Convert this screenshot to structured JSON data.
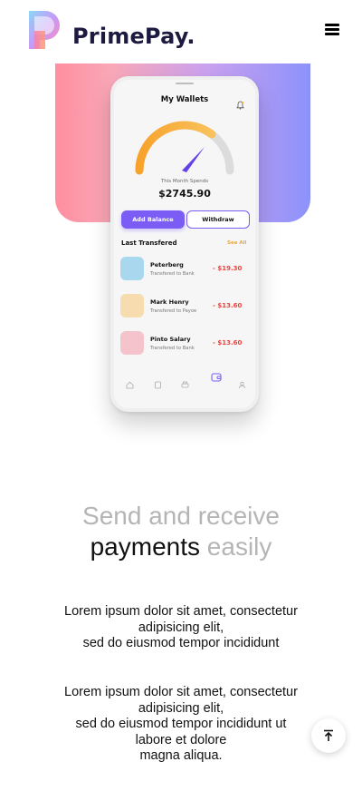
{
  "header": {
    "brand": "PrimePay.",
    "menu_icon": "hamburger-menu-icon",
    "logo_icon": "primepay-logo-icon"
  },
  "hero": {
    "gradient_colors": [
      "#ff8ea0",
      "#c9a1f0",
      "#8c92fb"
    ],
    "phone": {
      "title": "My Wallets",
      "spend_label": "This Month Spends",
      "spend_amount": "$2745.90",
      "add_balance_label": "Add Balance",
      "withdraw_label": "Withdraw",
      "last_transferred_title": "Last Transfered",
      "see_all_label": "See All",
      "transactions": [
        {
          "name": "Peterberg",
          "sub": "Transfered to Bank",
          "amount": "- $19.30",
          "color": "#a9d7ee"
        },
        {
          "name": "Mark Henry",
          "sub": "Transfered to Payoe",
          "amount": "- $13.60",
          "color": "#f6dcae"
        },
        {
          "name": "Pinto Salary",
          "sub": "Transfered to Bank",
          "amount": "- $13.60",
          "color": "#f5c3cc"
        }
      ],
      "accent_color": "#7b5cf5",
      "amount_color": "#f0413b",
      "nav_icons": [
        "home-icon",
        "card-icon",
        "print-icon",
        "wallet-icon",
        "user-icon"
      ]
    }
  },
  "headline": {
    "line1": "Send and receive",
    "line2_dark": "payments",
    "line2_grey": "easily"
  },
  "paragraphs": [
    {
      "line1": "Lorem ipsum dolor sit amet, consectetur",
      "line2": "adipisicing elit,",
      "line3": "sed do eiusmod tempor incididunt"
    },
    {
      "line1": "Lorem ipsum dolor sit amet, consectetur",
      "line2": "adipisicing elit,",
      "line3": "sed do eiusmod tempor incididunt ut",
      "line4": "labore et dolore",
      "line5": "magna aliqua."
    }
  ],
  "scroll_top_icon": "arrow-up-to-top-icon"
}
